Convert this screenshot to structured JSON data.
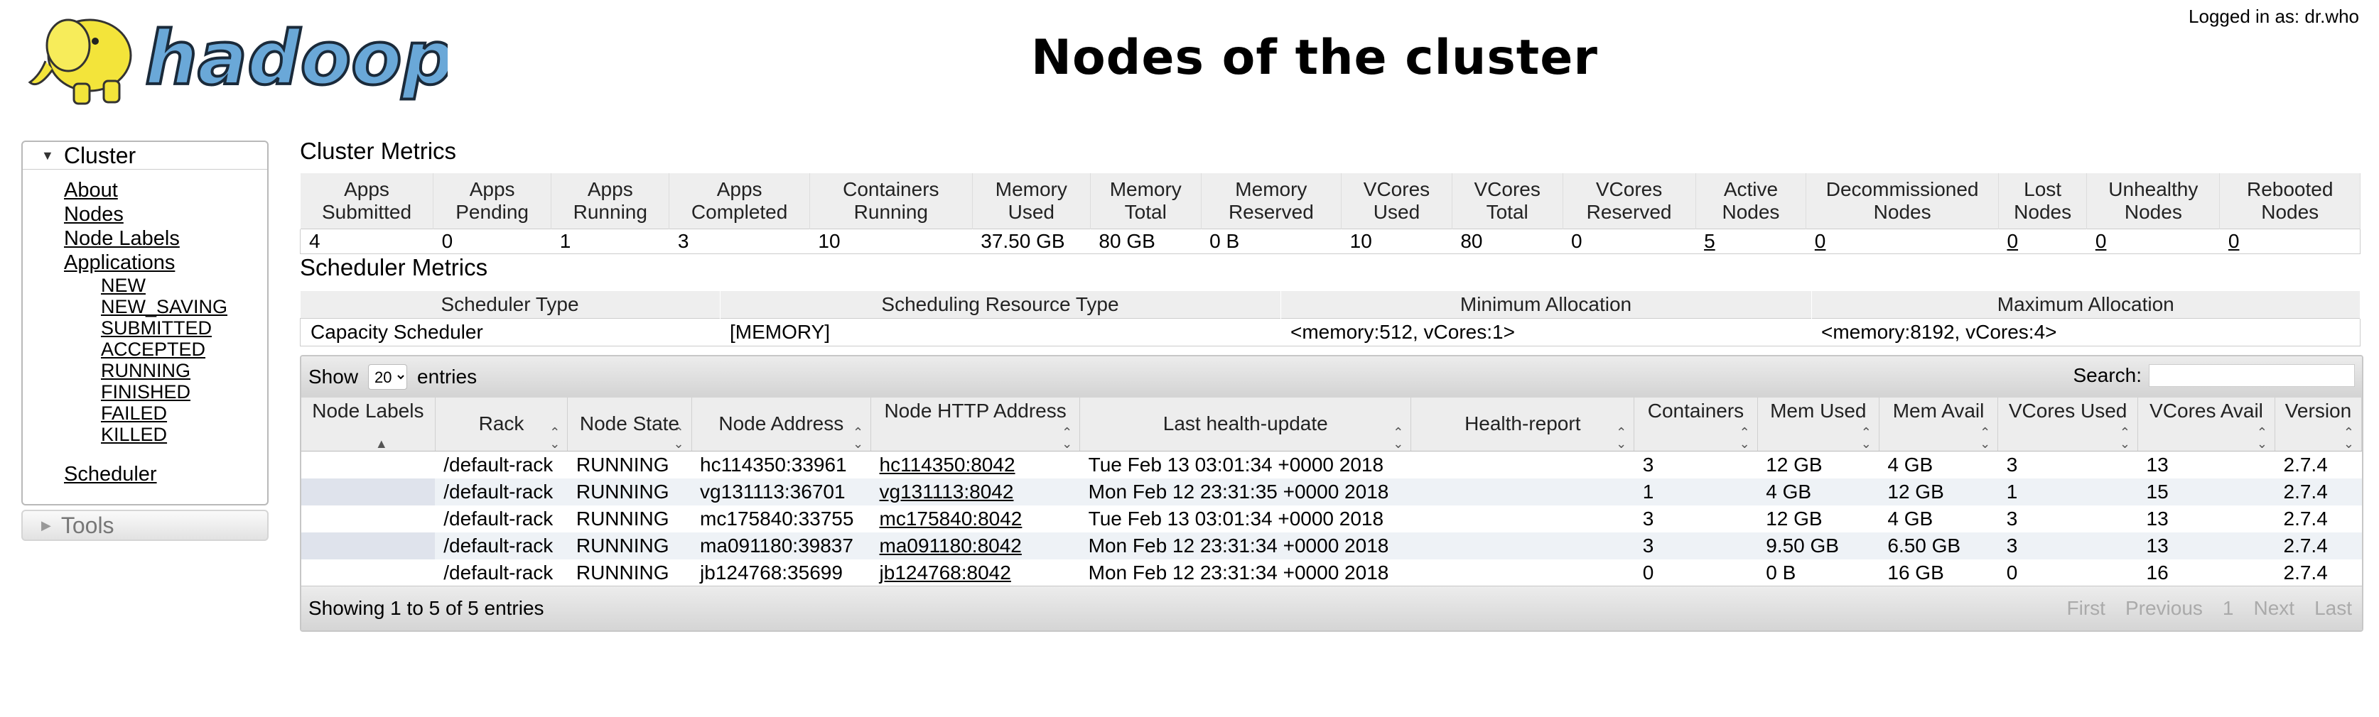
{
  "header": {
    "logo_text": "hadoop",
    "logged_in": "Logged in as: dr.who",
    "title": "Nodes of the cluster"
  },
  "nav": {
    "cluster_label": "Cluster",
    "about": "About",
    "nodes": "Nodes",
    "node_labels": "Node Labels",
    "applications": "Applications",
    "app_states": [
      "NEW",
      "NEW_SAVING",
      "SUBMITTED",
      "ACCEPTED",
      "RUNNING",
      "FINISHED",
      "FAILED",
      "KILLED"
    ],
    "scheduler": "Scheduler",
    "tools": "Tools"
  },
  "cluster_metrics": {
    "heading": "Cluster Metrics",
    "columns": [
      [
        "Apps",
        "Submitted"
      ],
      [
        "Apps",
        "Pending"
      ],
      [
        "Apps",
        "Running"
      ],
      [
        "Apps",
        "Completed"
      ],
      [
        "Containers",
        "Running"
      ],
      [
        "Memory",
        "Used"
      ],
      [
        "Memory",
        "Total"
      ],
      [
        "Memory",
        "Reserved"
      ],
      [
        "VCores",
        "Used"
      ],
      [
        "VCores",
        "Total"
      ],
      [
        "VCores",
        "Reserved"
      ],
      [
        "Active",
        "Nodes"
      ],
      [
        "Decommissioned",
        "Nodes"
      ],
      [
        "Lost",
        "Nodes"
      ],
      [
        "Unhealthy",
        "Nodes"
      ],
      [
        "Rebooted",
        "Nodes"
      ]
    ],
    "values": [
      "4",
      "0",
      "1",
      "3",
      "10",
      "37.50 GB",
      "80 GB",
      "0 B",
      "10",
      "80",
      "0",
      "5",
      "0",
      "0",
      "0",
      "0"
    ]
  },
  "scheduler_metrics": {
    "heading": "Scheduler Metrics",
    "columns": [
      "Scheduler Type",
      "Scheduling Resource Type",
      "Minimum Allocation",
      "Maximum Allocation"
    ],
    "values": [
      "Capacity Scheduler",
      "[MEMORY]",
      "<memory:512, vCores:1>",
      "<memory:8192, vCores:4>"
    ]
  },
  "nodes_table": {
    "show_label": "Show",
    "entries_value": "20",
    "entries_label": "entries",
    "search_label": "Search:",
    "columns": [
      "Node Labels",
      "Rack",
      "Node State",
      "Node Address",
      "Node HTTP Address",
      "Last health-update",
      "Health-report",
      "Containers",
      "Mem Used",
      "Mem Avail",
      "VCores Used",
      "VCores Avail",
      "Version"
    ],
    "rows": [
      [
        "",
        "/default-rack",
        "RUNNING",
        "hc114350:33961",
        "hc114350:8042",
        "Tue Feb 13 03:01:34 +0000 2018",
        "",
        "3",
        "12 GB",
        "4 GB",
        "3",
        "13",
        "2.7.4"
      ],
      [
        "",
        "/default-rack",
        "RUNNING",
        "vg131113:36701",
        "vg131113:8042",
        "Mon Feb 12 23:31:35 +0000 2018",
        "",
        "1",
        "4 GB",
        "12 GB",
        "1",
        "15",
        "2.7.4"
      ],
      [
        "",
        "/default-rack",
        "RUNNING",
        "mc175840:33755",
        "mc175840:8042",
        "Tue Feb 13 03:01:34 +0000 2018",
        "",
        "3",
        "12 GB",
        "4 GB",
        "3",
        "13",
        "2.7.4"
      ],
      [
        "",
        "/default-rack",
        "RUNNING",
        "ma091180:39837",
        "ma091180:8042",
        "Mon Feb 12 23:31:34 +0000 2018",
        "",
        "3",
        "9.50 GB",
        "6.50 GB",
        "3",
        "13",
        "2.7.4"
      ],
      [
        "",
        "/default-rack",
        "RUNNING",
        "jb124768:35699",
        "jb124768:8042",
        "Mon Feb 12 23:31:34 +0000 2018",
        "",
        "0",
        "0 B",
        "16 GB",
        "0",
        "16",
        "2.7.4"
      ]
    ],
    "footer_info": "Showing 1 to 5 of 5 entries",
    "pager": [
      "First",
      "Previous",
      "1",
      "Next",
      "Last"
    ]
  },
  "colors": {
    "header_bg": "#eeeeee",
    "even_row": "#eef2f6",
    "logo_yellow": "#f3e43a",
    "logo_blue": "#6aa8d8"
  }
}
